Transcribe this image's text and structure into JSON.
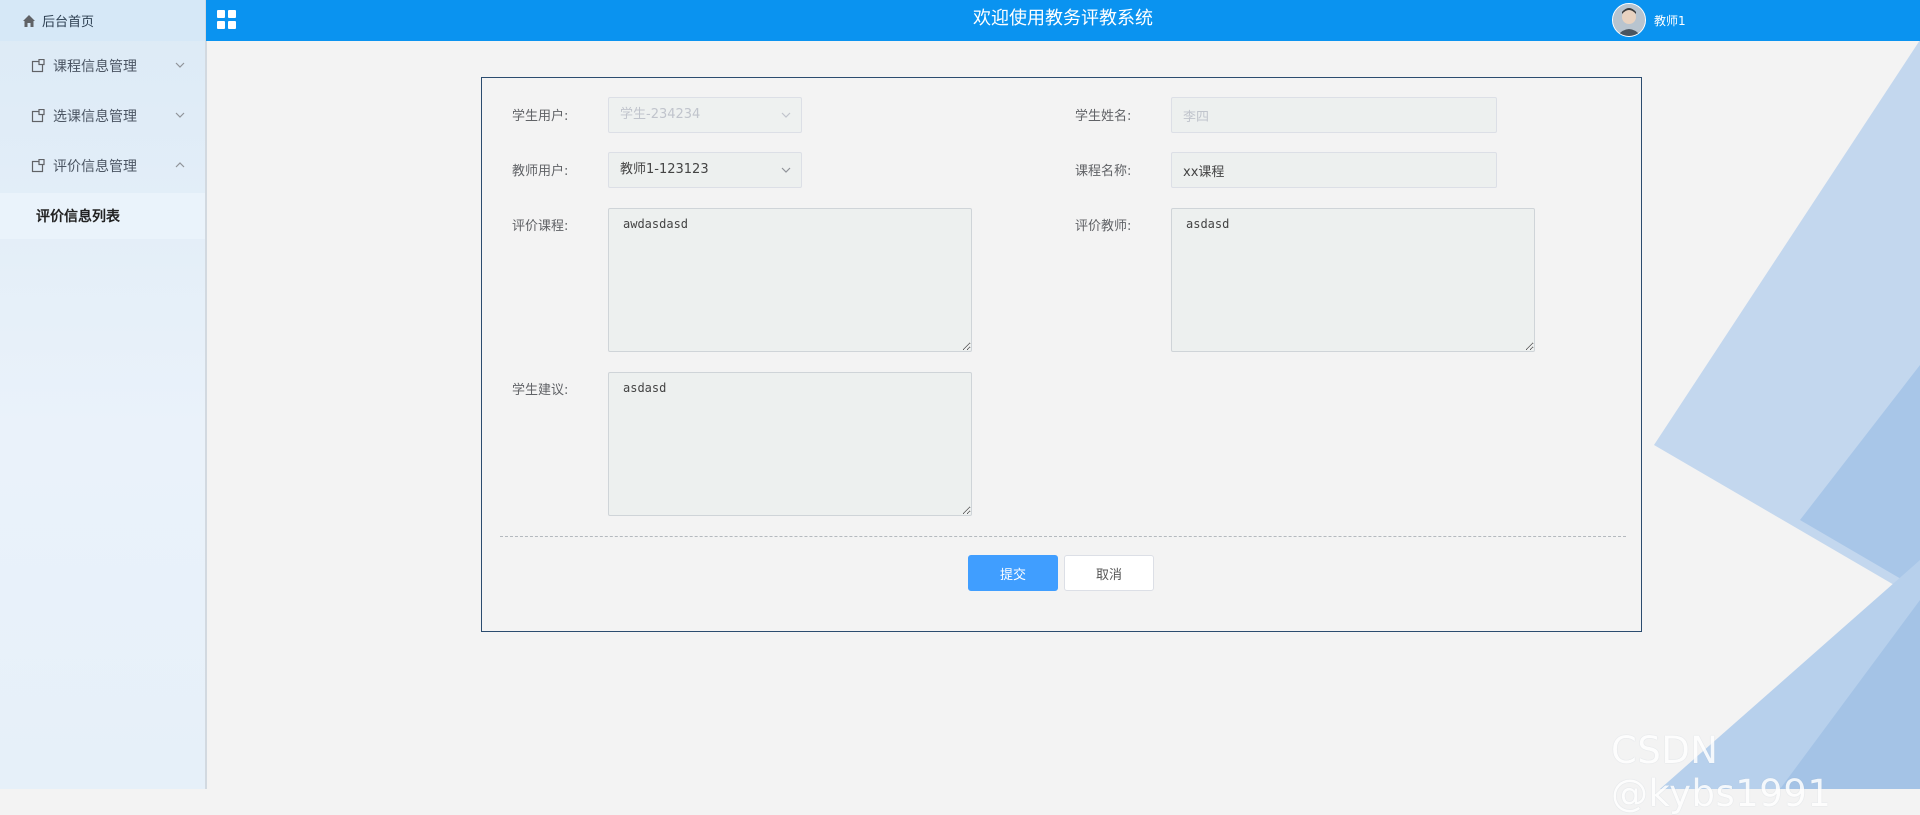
{
  "header": {
    "title": "欢迎使用教务评教系统",
    "user_name": "教师1",
    "menu_toggle_icon": "grid-icon"
  },
  "sidebar": {
    "home_label": "后台首页",
    "items": [
      {
        "label": "课程信息管理",
        "icon": "note-icon",
        "expanded": false
      },
      {
        "label": "选课信息管理",
        "icon": "note-icon",
        "expanded": false
      },
      {
        "label": "评价信息管理",
        "icon": "note-icon",
        "expanded": true
      }
    ],
    "submenu": [
      {
        "label": "评价信息列表",
        "active": true
      }
    ]
  },
  "form": {
    "student_user": {
      "label": "学生用户:",
      "value": "学生-234234",
      "disabled": true
    },
    "student_name": {
      "label": "学生姓名:",
      "value": "李四",
      "disabled": true
    },
    "teacher_user": {
      "label": "教师用户:",
      "value": "教师1-123123"
    },
    "course_name": {
      "label": "课程名称:",
      "value": "xx课程"
    },
    "course_eval": {
      "label": "评价课程:",
      "value": "awdasdasd"
    },
    "teacher_eval": {
      "label": "评价教师:",
      "value": "asdasd"
    },
    "student_suggestion": {
      "label": "学生建议:",
      "value": "asdasd"
    },
    "submit_label": "提交",
    "cancel_label": "取消"
  },
  "watermark": "CSDN @kybs1991",
  "colors": {
    "topbar": "#0a93f0",
    "primary_button": "#409eff",
    "panel_border": "#2b4c6f"
  }
}
